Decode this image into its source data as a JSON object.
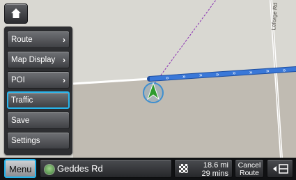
{
  "map": {
    "road_labels": [
      "Leforge Rd"
    ],
    "route_color": "#3a78d8",
    "vehicle_color": "#2e9b2e"
  },
  "menu": {
    "items": [
      {
        "label": "Route",
        "has_submenu": true
      },
      {
        "label": "Map Display",
        "has_submenu": true
      },
      {
        "label": "POI",
        "has_submenu": true
      },
      {
        "label": "Traffic",
        "has_submenu": false,
        "selected": true
      },
      {
        "label": "Save",
        "has_submenu": false
      },
      {
        "label": "Settings",
        "has_submenu": false
      }
    ],
    "chevron": "›"
  },
  "bottom": {
    "menu_label": "Menu",
    "current_road": "Geddes Rd",
    "distance": "18.6 mi",
    "time": "29 mins",
    "cancel_line1": "Cancel",
    "cancel_line2": "Route"
  },
  "accent_color": "#28b6ee"
}
